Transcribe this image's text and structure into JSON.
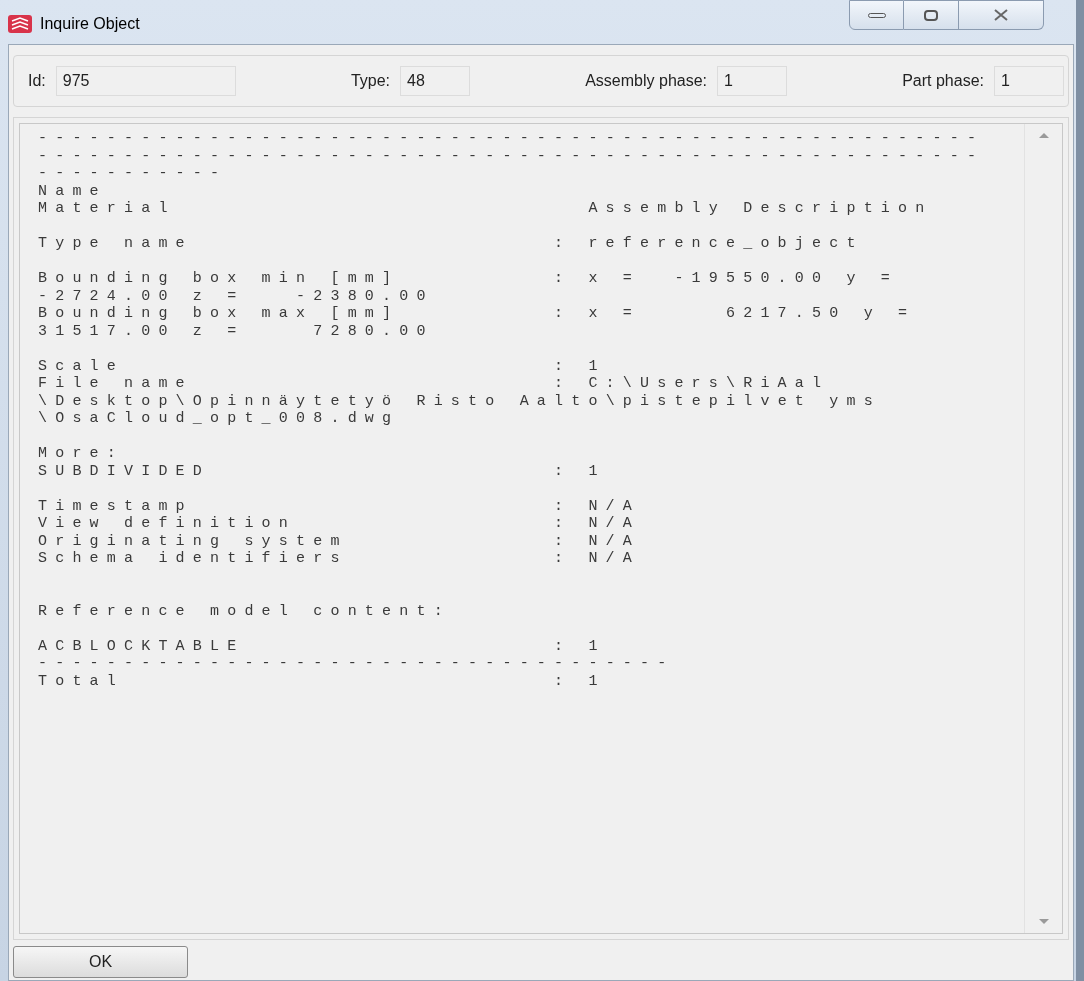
{
  "window": {
    "title": "Inquire Object",
    "controls": [
      {
        "kind": "minimize"
      },
      {
        "kind": "maximize"
      },
      {
        "kind": "close"
      }
    ]
  },
  "fields": [
    {
      "label": "Id:",
      "value": "975",
      "kind": "wide"
    },
    {
      "label": "Type:",
      "value": "48",
      "kind": "narrow"
    },
    {
      "label": "Assembly phase:",
      "value": "1",
      "kind": "narrow"
    },
    {
      "label": "Part phase:",
      "value": "1",
      "kind": "narrow"
    }
  ],
  "report": [
    {
      "kind": "text",
      "text": "-------------------------------------------------------"
    },
    {
      "kind": "text",
      "text": "-------------------------------------------------------"
    },
    {
      "kind": "text",
      "text": "-----------"
    },
    {
      "kind": "text",
      "text": "Name"
    },
    {
      "kind": "pair",
      "label": "Material",
      "value": "  Assembly Description"
    },
    {
      "kind": "blank"
    },
    {
      "kind": "pair",
      "label": "Type name",
      "value": ": reference_object"
    },
    {
      "kind": "blank"
    },
    {
      "kind": "pair",
      "label": "Bounding box min [mm]",
      "value": ": x =  -19550.00 y ="
    },
    {
      "kind": "text",
      "text": "-2724.00 z =   -2380.00"
    },
    {
      "kind": "pair",
      "label": "Bounding box max [mm]",
      "value": ": x =     6217.50 y ="
    },
    {
      "kind": "text",
      "text": "31517.00 z =    7280.00"
    },
    {
      "kind": "blank"
    },
    {
      "kind": "pair",
      "label": "Scale",
      "value": ": 1"
    },
    {
      "kind": "pair",
      "label": "File name",
      "value": ": C:\\Users\\RiAal"
    },
    {
      "kind": "text",
      "text": "\\Desktop\\Opinnäytetyö Risto Aalto\\pistepilvet yms"
    },
    {
      "kind": "text",
      "text": "\\OsaCloud_opt_008.dwg"
    },
    {
      "kind": "blank"
    },
    {
      "kind": "text",
      "text": "More:"
    },
    {
      "kind": "pair",
      "label": "SUBDIVIDED",
      "value": ": 1"
    },
    {
      "kind": "blank"
    },
    {
      "kind": "pair",
      "label": "Timestamp",
      "value": ": N/A"
    },
    {
      "kind": "pair",
      "label": "View definition",
      "value": ": N/A"
    },
    {
      "kind": "pair",
      "label": "Originating system",
      "value": ": N/A"
    },
    {
      "kind": "pair",
      "label": "Schema identifiers",
      "value": ": N/A"
    },
    {
      "kind": "blank"
    },
    {
      "kind": "blank"
    },
    {
      "kind": "text",
      "text": "Reference model content:"
    },
    {
      "kind": "blank"
    },
    {
      "kind": "pair",
      "label": "ACBLOCKTABLE",
      "value": ": 1"
    },
    {
      "kind": "text",
      "text": "-------------------------------------"
    },
    {
      "kind": "pair",
      "label": "Total",
      "value": ": 1"
    }
  ],
  "buttons": [
    {
      "label": "OK"
    }
  ]
}
